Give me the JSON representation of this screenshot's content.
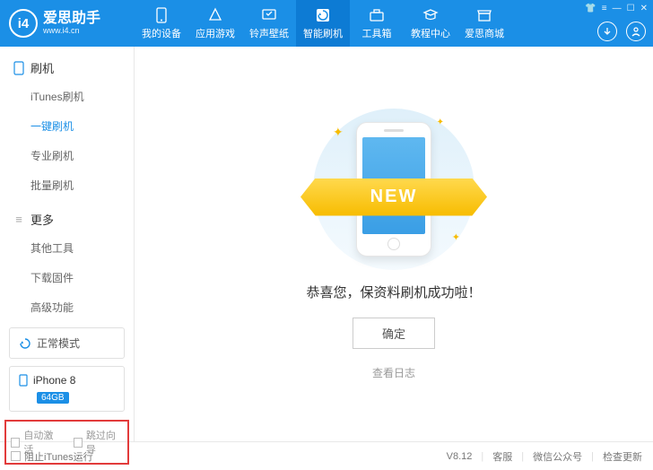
{
  "header": {
    "logo_text": "爱思助手",
    "logo_sub": "www.i4.cn",
    "logo_badge": "i4",
    "tabs": [
      {
        "label": "我的设备",
        "icon": "device-icon"
      },
      {
        "label": "应用游戏",
        "icon": "apps-icon"
      },
      {
        "label": "铃声壁纸",
        "icon": "ringtone-icon"
      },
      {
        "label": "智能刷机",
        "icon": "flash-icon",
        "active": true
      },
      {
        "label": "工具箱",
        "icon": "toolbox-icon"
      },
      {
        "label": "教程中心",
        "icon": "tutorial-icon"
      },
      {
        "label": "爱思商城",
        "icon": "store-icon"
      }
    ]
  },
  "sidebar": {
    "section1": {
      "title": "刷机",
      "items": [
        "iTunes刷机",
        "一键刷机",
        "专业刷机",
        "批量刷机"
      ],
      "active_index": 1
    },
    "section2": {
      "title": "更多",
      "items": [
        "其他工具",
        "下载固件",
        "高级功能"
      ]
    },
    "mode": "正常模式",
    "device": {
      "name": "iPhone 8",
      "storage": "64GB"
    },
    "checkboxes": {
      "auto_activate": "自动激活",
      "skip_guide": "跳过向导"
    }
  },
  "main": {
    "ribbon": "NEW",
    "message": "恭喜您，保资料刷机成功啦！",
    "confirm": "确定",
    "view_log": "查看日志"
  },
  "statusbar": {
    "block_itunes": "阻止iTunes运行",
    "version": "V8.12",
    "support": "客服",
    "wechat": "微信公众号",
    "update": "检查更新"
  }
}
